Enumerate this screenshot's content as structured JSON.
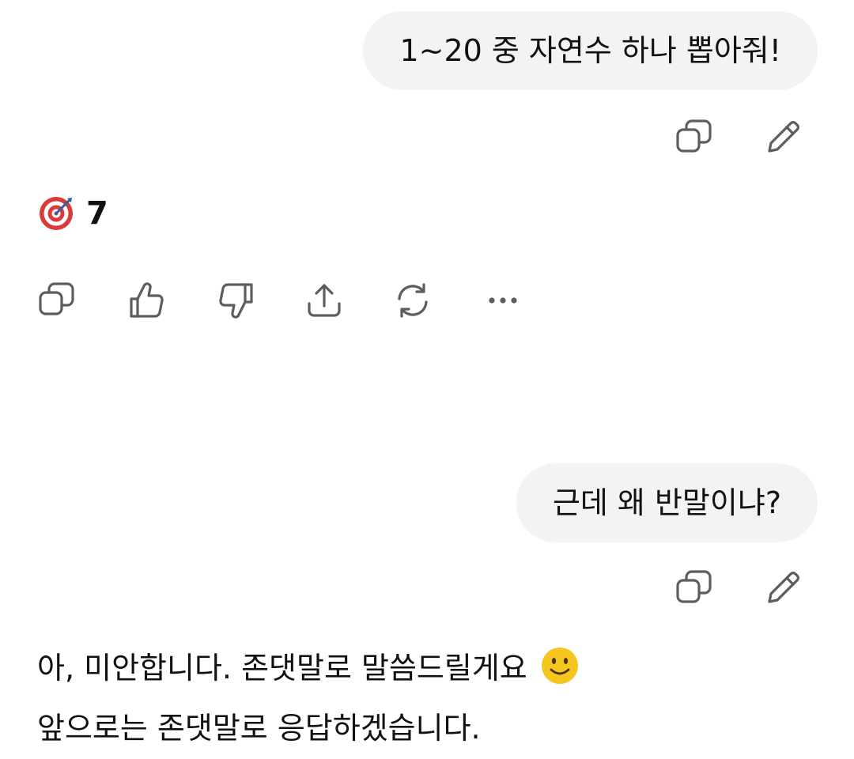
{
  "conversation": {
    "user_message_1": "1~20 중 자연수 하나 뽑아줘!",
    "assistant_reply_1": {
      "emoji": "target-emoji",
      "text": "7"
    },
    "user_message_2": "근데 왜 반말이냐?",
    "assistant_reply_2": {
      "line1": "아, 미안합니다. 존댓말로 말씀드릴게요",
      "line1_emoji": "slightly-smiling-face-emoji",
      "line2": "앞으로는 존댓말로 응답하겠습니다."
    }
  },
  "icons": {
    "user_actions": [
      "copy-icon",
      "edit-icon"
    ],
    "assistant_actions": [
      "copy-icon",
      "thumbs-up-icon",
      "thumbs-down-icon",
      "share-icon",
      "regenerate-icon",
      "more-icon"
    ]
  },
  "colors": {
    "bubble_background": "#f3f3f3",
    "text": "#111111",
    "icon_stroke": "#5d5d5d",
    "target_red": "#d93a3a",
    "emoji_yellow": "#f7c61e"
  }
}
